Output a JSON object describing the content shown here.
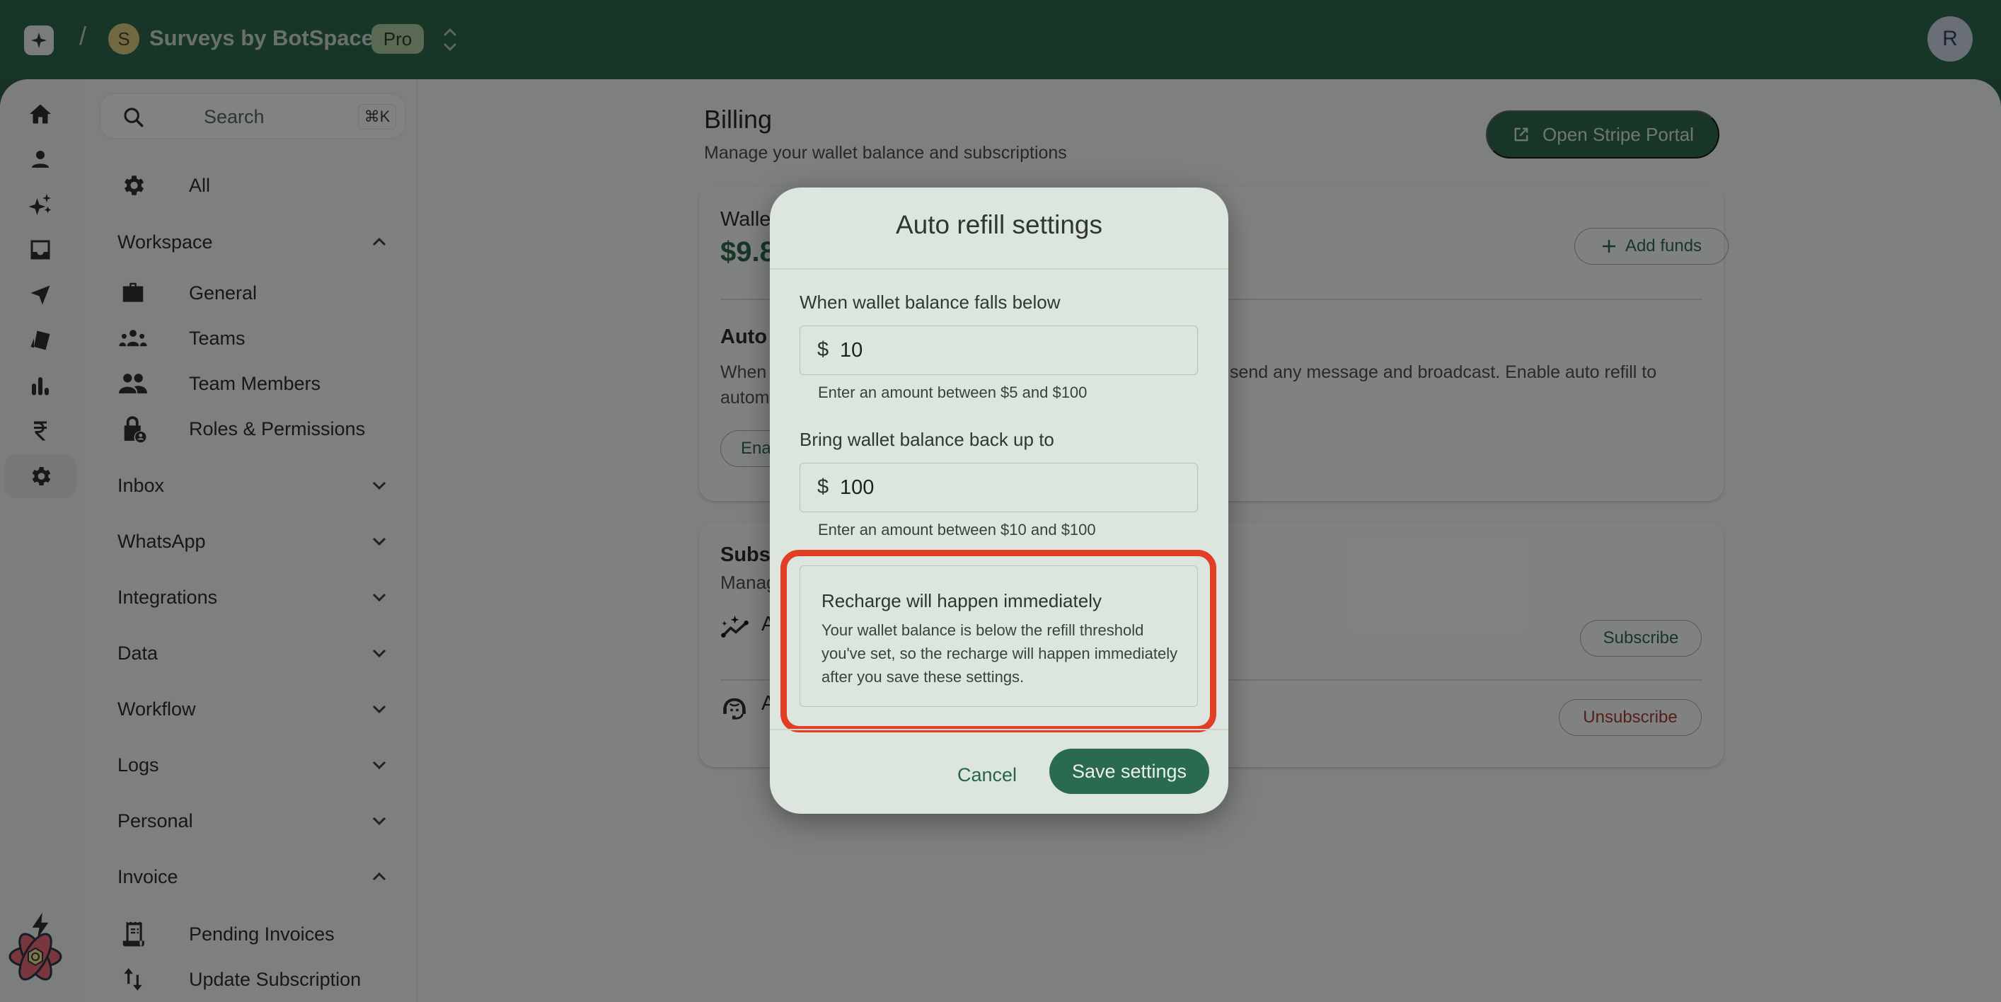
{
  "topbar": {
    "crumb_separator": "/",
    "workspace_initial": "S",
    "workspace_name": "Surveys by BotSpace",
    "plan_badge": "Pro",
    "user_initial": "R"
  },
  "rail": {
    "icons": [
      "home-icon",
      "contacts-icon",
      "ai-sparkles-icon",
      "inbox-icon",
      "broadcast-send-icon",
      "templates-icon",
      "analytics-icon",
      "billing-rupee-icon",
      "settings-icon"
    ],
    "active": "settings-icon"
  },
  "sidebar": {
    "search_placeholder": "Search",
    "search_shortcut": "⌘K",
    "all_label": "All",
    "groups": [
      {
        "label": "Workspace",
        "expanded": true,
        "items": [
          "General",
          "Teams",
          "Team Members",
          "Roles & Permissions"
        ]
      },
      {
        "label": "Inbox",
        "expanded": false
      },
      {
        "label": "WhatsApp",
        "expanded": false
      },
      {
        "label": "Integrations",
        "expanded": false
      },
      {
        "label": "Data",
        "expanded": false
      },
      {
        "label": "Workflow",
        "expanded": false
      },
      {
        "label": "Logs",
        "expanded": false
      },
      {
        "label": "Personal",
        "expanded": false
      },
      {
        "label": "Invoice",
        "expanded": true,
        "items": [
          "Pending Invoices",
          "Update Subscription"
        ]
      }
    ]
  },
  "main": {
    "title": "Billing",
    "subtitle": "Manage your wallet balance and subscriptions",
    "stripe_button": "Open Stripe Portal",
    "wallet": {
      "title_partial": "Walle",
      "amount_partial": "$9.8",
      "add_funds": "Add funds"
    },
    "auto_refill": {
      "title_partial": "Auto",
      "desc_left_line1": "When",
      "desc_left_line2": "autom",
      "desc_right": "send any message and broadcast. Enable auto refill to",
      "enable_partial": "Ena"
    },
    "subscriptions": {
      "title_partial": "Subs",
      "subtitle_partial": "Manag",
      "rows": [
        {
          "icon": "sparkle-chart-icon",
          "label_partial": "A",
          "action": "Subscribe"
        },
        {
          "icon": "support-agent-icon",
          "label_partial": "A",
          "action": "Unsubscribe"
        }
      ]
    }
  },
  "dialog": {
    "title": "Auto refill settings",
    "threshold_label": "When wallet balance falls below",
    "threshold_currency": "$",
    "threshold_value": "10",
    "threshold_help": "Enter an amount between $5 and $100",
    "target_label": "Bring wallet balance back up to",
    "target_currency": "$",
    "target_value": "100",
    "target_help": "Enter an amount between $10 and $100",
    "notice_title": "Recharge will happen immediately",
    "notice_body": "Your wallet balance is below the refill threshold you've set, so the recharge will happen immediately after you save these settings.",
    "cancel": "Cancel",
    "save": "Save settings"
  },
  "colors": {
    "brand_green": "#1f5a3d",
    "primary_button": "#2a6b50",
    "highlight_red": "#e23e26",
    "danger_text": "#9b2a22"
  }
}
